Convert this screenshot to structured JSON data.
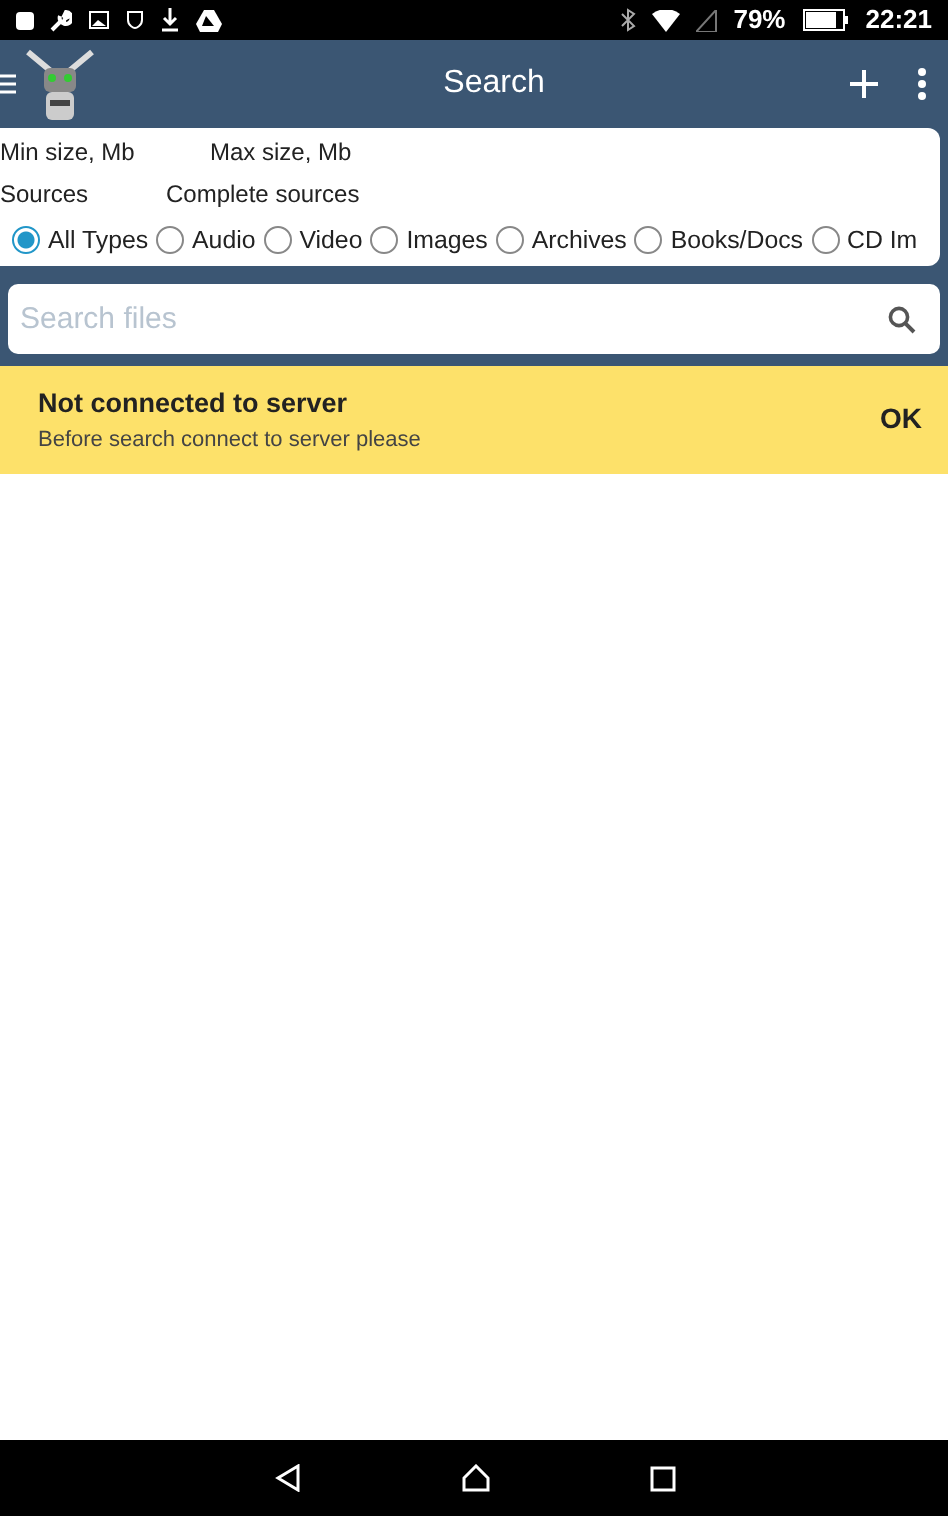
{
  "status_bar": {
    "battery": "79%",
    "time": "22:21"
  },
  "app_bar": {
    "title": "Search"
  },
  "filters": {
    "min_size": "Min size, Mb",
    "max_size": "Max size, Mb",
    "sources": "Sources",
    "complete_sources": "Complete sources"
  },
  "types": [
    {
      "label": "All Types",
      "selected": true
    },
    {
      "label": "Audio",
      "selected": false
    },
    {
      "label": "Video",
      "selected": false
    },
    {
      "label": "Images",
      "selected": false
    },
    {
      "label": "Archives",
      "selected": false
    },
    {
      "label": "Books/Docs",
      "selected": false
    },
    {
      "label": "CD Im",
      "selected": false
    }
  ],
  "search": {
    "placeholder": "Search files"
  },
  "banner": {
    "title": "Not connected to server",
    "message": "Before search connect to server please",
    "action": "OK"
  }
}
